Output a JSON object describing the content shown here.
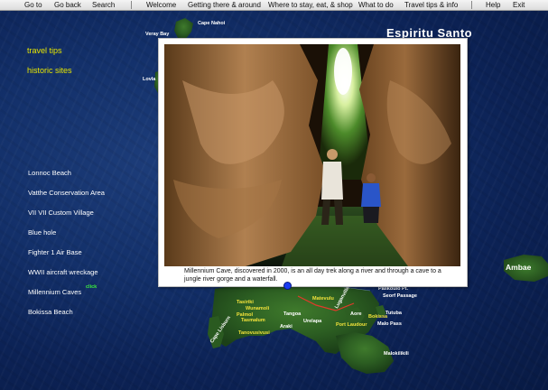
{
  "menu": {
    "items": [
      "Go to",
      "Go back",
      "Search",
      "Welcome",
      "Getting there & around",
      "Where to stay, eat, & shop",
      "What to do",
      "Travel tips & info",
      "Help",
      "Exit"
    ]
  },
  "map": {
    "title": "Espiritu Santo",
    "labels": {
      "cape_nahoi": "Cape Nahoi",
      "veray_bay": "Veray Bay",
      "lovla": "Lovla",
      "ambae": "Ambae",
      "palikoulo": "Palikoulo Pt.",
      "seorf": "Seorf Passage",
      "tutuba": "Tutuba",
      "malo_pass": "Malo Pass",
      "malokilikili": "Malokilikili",
      "aore": "Aore",
      "tasiriki": "Tasiriki",
      "wunamoli": "Wunamoli",
      "palmol": "Palmol",
      "tasmalum": "Tasmalum",
      "tanovusivusi": "Tanovusivusi",
      "tangoa": "Tangoa",
      "araki": "Araki",
      "urelapa": "Urelapa",
      "port_laudour": "Port Laudour",
      "cape_lisburn": "Cape Lisburn",
      "matevulu": "Matevulu",
      "bokissa": "Bokissa",
      "luganville": "Luganville"
    }
  },
  "tips_menu": {
    "travel_tips": "travel tips",
    "historic_sites": "historic sites"
  },
  "places": [
    "Lonnoc Beach",
    "Vatthe Conservation Area",
    "VII VII Custom Village",
    "Blue hole",
    "Fighter 1 Air Base",
    "WWII aircraft wreckage",
    "Millennium Caves",
    "Bokissa Beach"
  ],
  "click_hint": "click",
  "popup": {
    "caption": "Millennium Cave, discovered in 2000, is an all day trek along a river and through a cave to a jungle river gorge and a waterfall."
  },
  "colors": {
    "menubar": "#dcdcdc",
    "ocean": "#13306a",
    "tips": "#e8e800",
    "place_text": "#ffffff",
    "click_tag": "#3cf03c",
    "marker": "#1a3cf0"
  },
  "icons": {
    "location_marker": "location-marker-icon"
  }
}
